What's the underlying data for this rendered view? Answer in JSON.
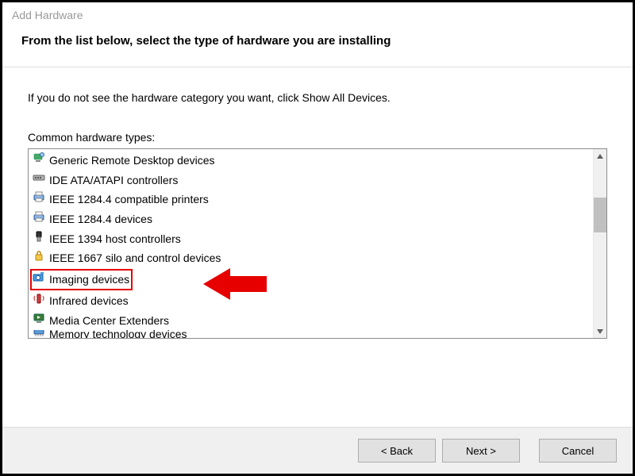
{
  "window": {
    "title": "Add Hardware"
  },
  "header": {
    "title": "From the list below, select the type of hardware you are installing"
  },
  "content": {
    "hint": "If you do not see the hardware category you want, click Show All Devices.",
    "list_label": "Common hardware types:",
    "items": [
      {
        "icon": "remote-desktop-icon",
        "label": "Generic Remote Desktop devices",
        "highlight": false
      },
      {
        "icon": "ide-controller-icon",
        "label": "IDE ATA/ATAPI controllers",
        "highlight": false
      },
      {
        "icon": "printer-icon",
        "label": "IEEE 1284.4 compatible printers",
        "highlight": false
      },
      {
        "icon": "printer-icon",
        "label": "IEEE 1284.4 devices",
        "highlight": false
      },
      {
        "icon": "usb-host-icon",
        "label": "IEEE 1394 host controllers",
        "highlight": false
      },
      {
        "icon": "lock-silo-icon",
        "label": "IEEE 1667 silo and control devices",
        "highlight": false
      },
      {
        "icon": "imaging-icon",
        "label": "Imaging devices",
        "highlight": true
      },
      {
        "icon": "infrared-icon",
        "label": "Infrared devices",
        "highlight": false
      },
      {
        "icon": "media-center-icon",
        "label": "Media Center Extenders",
        "highlight": false
      },
      {
        "icon": "memory-tech-icon",
        "label": "Memory technology devices",
        "highlight": false,
        "partial": true
      }
    ]
  },
  "footer": {
    "back_label": "< Back",
    "next_label": "Next >",
    "cancel_label": "Cancel"
  },
  "annotation": {
    "arrow_color": "#e60000"
  }
}
